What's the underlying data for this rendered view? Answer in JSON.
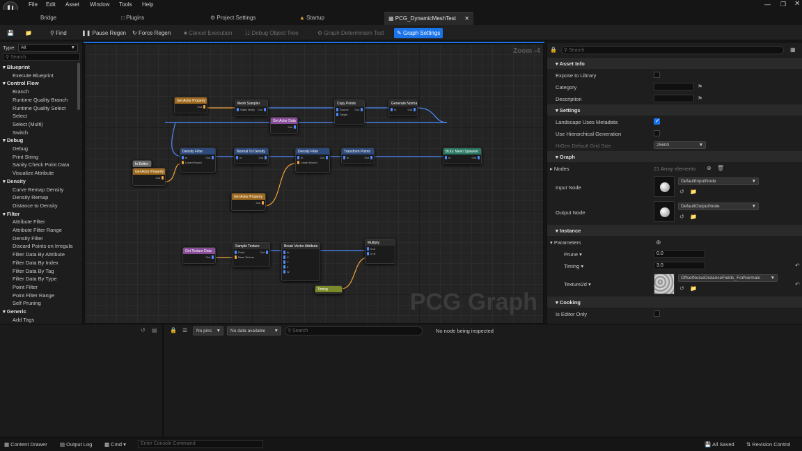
{
  "menu": [
    "File",
    "Edit",
    "Asset",
    "Window",
    "Tools",
    "Help"
  ],
  "tabs": {
    "bridge": "Bridge",
    "plugins": "Plugins",
    "project_settings": "Project Settings",
    "startup": "Startup",
    "pcg": "PCG_DynamicMeshTest"
  },
  "toolbar": {
    "find": "Find",
    "pause": "Pause Regen",
    "force": "Force Regen",
    "cancel": "Cancel Execution",
    "debug_tree": "Debug Object Tree",
    "determinism": "Graph Determinism Test",
    "graph_settings": "Graph Settings"
  },
  "palette": {
    "type_label": "Type:",
    "type_value": "All",
    "search_placeholder": "Search",
    "rows": [
      {
        "t": "Blueprint",
        "c": true
      },
      {
        "t": "Execute Blueprint"
      },
      {
        "t": "Control Flow",
        "c": true
      },
      {
        "t": "Branch"
      },
      {
        "t": "Runtime Quality Branch"
      },
      {
        "t": "Runtime Quality Select"
      },
      {
        "t": "Select"
      },
      {
        "t": "Select (Multi)"
      },
      {
        "t": "Switch"
      },
      {
        "t": "Debug",
        "c": true
      },
      {
        "t": "Debug"
      },
      {
        "t": "Print String"
      },
      {
        "t": "Sanity Check Point Data"
      },
      {
        "t": "Visualize Attribute"
      },
      {
        "t": "Density",
        "c": true
      },
      {
        "t": "Curve Remap Density"
      },
      {
        "t": "Density Remap"
      },
      {
        "t": "Distance to Density"
      },
      {
        "t": "Filter",
        "c": true
      },
      {
        "t": "Attribute Filter"
      },
      {
        "t": "Attribute Filter Range"
      },
      {
        "t": "Density Filter"
      },
      {
        "t": "Discard Points on Irregula"
      },
      {
        "t": "Filter Data By Attribute"
      },
      {
        "t": "Filter Data By Index"
      },
      {
        "t": "Filter Data By Tag"
      },
      {
        "t": "Filter Data By Type"
      },
      {
        "t": "Point Filter"
      },
      {
        "t": "Point Filter Range"
      },
      {
        "t": "Self Pruning"
      },
      {
        "t": "Generic",
        "c": true
      },
      {
        "t": "Add Tags"
      }
    ]
  },
  "graph": {
    "zoom": "Zoom -4",
    "watermark": "PCG Graph",
    "nodes": [
      {
        "id": "n1",
        "title": "Get Actor Property",
        "color": "#a06a1e",
        "pins": [
          "Out"
        ]
      },
      {
        "id": "n2",
        "title": "Mesh Sampler",
        "color": "#2d2d2d",
        "pins": [
          "Static Mesh",
          "Out"
        ]
      },
      {
        "id": "n3",
        "title": "Copy Points",
        "color": "#2d2d2d",
        "pins": [
          "Source",
          "Target",
          "Out"
        ]
      },
      {
        "id": "n4",
        "title": "Generate Normal",
        "color": "#2d2d2d",
        "pins": [
          "In",
          "Out"
        ]
      },
      {
        "id": "n5",
        "title": "Get Actor Data",
        "color": "#8a4d9a",
        "pins": [
          "Out"
        ]
      },
      {
        "id": "n6",
        "title": "Density Filter",
        "color": "#2d4a7a",
        "pins": [
          "In",
          "Lower Bound",
          "Out"
        ]
      },
      {
        "id": "n7",
        "title": "Normal To Density",
        "color": "#2d4a7a",
        "pins": [
          "In",
          "Out"
        ]
      },
      {
        "id": "n8",
        "title": "Density Filter",
        "color": "#2d4a7a",
        "pins": [
          "In",
          "Lower Bound",
          "Out"
        ]
      },
      {
        "id": "n9",
        "title": "Transform Points",
        "color": "#2d4a7a",
        "pins": [
          "In",
          "Out"
        ]
      },
      {
        "id": "n10",
        "title": "BUG: Mesh Spawner",
        "color": "#2a7a66",
        "pins": [
          "In",
          "Out"
        ]
      },
      {
        "id": "n11",
        "title": "In Editor",
        "color": "#6a6a6a",
        "pins": []
      },
      {
        "id": "n12",
        "title": "Get Actor Property",
        "color": "#a06a1e",
        "pins": [
          "Out"
        ]
      },
      {
        "id": "n13",
        "title": "Get Actor Property",
        "color": "#a06a1e",
        "pins": [
          "Out"
        ]
      },
      {
        "id": "n14",
        "title": "Get Texture Data",
        "color": "#8a4d9a",
        "pins": [
          "Out"
        ]
      },
      {
        "id": "n15",
        "title": "Sample Texture",
        "color": "#2d2d2d",
        "pins": [
          "Point",
          "Base Texture",
          "Out"
        ]
      },
      {
        "id": "n16",
        "title": "Break Vector Attribute",
        "color": "#2d2d2d",
        "pins": [
          "In",
          "X",
          "Y",
          "Z",
          "W"
        ]
      },
      {
        "id": "n17",
        "title": "Multiply",
        "color": "#2d2d2d",
        "pins": [
          "In A",
          "In B"
        ]
      },
      {
        "id": "n18",
        "title": "Timing",
        "color": "#7a8a2a",
        "pins": []
      }
    ]
  },
  "details": {
    "search_placeholder": "Search",
    "asset_info": "Asset Info",
    "expose": "Expose to Library",
    "category": "Category",
    "description": "Description",
    "settings": "Settings",
    "landscape_meta": "Landscape Uses Metadata",
    "hierarchical": "Use Hierarchical Generation",
    "higen_grid": "HiGen Default Grid Size",
    "higen_value": "25600",
    "graph": "Graph",
    "nodes": "Nodes",
    "nodes_count": "21 Array elements",
    "input_node": "Input Node",
    "input_value": "DefaultInputNode",
    "output_node": "Output Node",
    "output_value": "DefaultOutputNode",
    "instance": "Instance",
    "parameters": "Parameters",
    "prune": "Prune",
    "prune_value": "0.0",
    "timing": "Timing",
    "timing_value": "3.0",
    "texture": "Texture2d",
    "texture_value": "OffsetNoiseDistanceFields_ForNormals",
    "cooking": "Cooking",
    "editor_only": "Is Editor Only"
  },
  "inspector": {
    "pins": "No pins",
    "data": "No data available",
    "search_placeholder": "Search",
    "status": "No node being inspected"
  },
  "status": {
    "content_drawer": "Content Drawer",
    "output_log": "Output Log",
    "cmd": "Cmd",
    "console_placeholder": "Enter Console Command",
    "all_saved": "All Saved",
    "revision": "Revision Control"
  },
  "colors": {
    "accent": "#1a73e8",
    "wire_blue": "#4e8cff",
    "wire_orange": "#f2a33a"
  }
}
